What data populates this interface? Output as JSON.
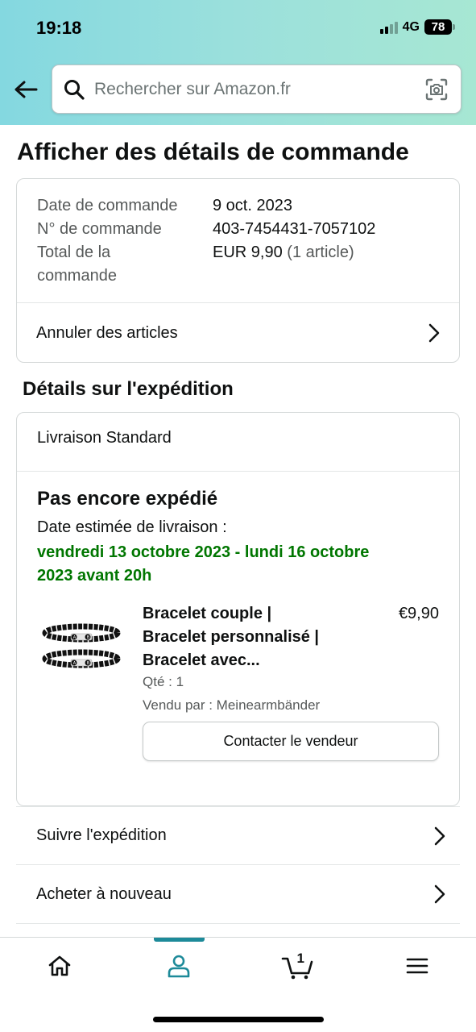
{
  "status_bar": {
    "time": "19:18",
    "network": "4G",
    "battery": "78"
  },
  "search": {
    "placeholder": "Rechercher sur Amazon.fr"
  },
  "page": {
    "title": "Afficher des détails de commande"
  },
  "order": {
    "date_label": "Date de commande",
    "date_value": "9 oct. 2023",
    "number_label": "N° de commande",
    "number_value": "403-7454431-7057102",
    "total_label_line1": "Total de la",
    "total_label_line2": "commande",
    "total_value": "EUR 9,90",
    "total_count": "(1 article)",
    "cancel_label": "Annuler des articles"
  },
  "shipping": {
    "section_title": "Détails sur l'expédition",
    "method": "Livraison Standard",
    "status": "Pas encore expédié",
    "eta_label": "Date estimée de livraison :",
    "eta_line1": "vendredi 13 octobre 2023 - lundi 16 octobre",
    "eta_line2": "2023 avant 20h"
  },
  "product": {
    "name_line1": "Bracelet couple |",
    "name_line2": "Bracelet personnalisé |",
    "name_line3": "Bracelet avec...",
    "price": "€9,90",
    "qty": "Qté : 1",
    "seller": "Vendu par : Meinearmbänder",
    "contact_label": "Contacter le vendeur"
  },
  "actions": {
    "track_label": "Suivre l'expédition",
    "rebuy_label": "Acheter à nouveau"
  },
  "bottom_nav": {
    "cart_count": "1",
    "active_tab": "account",
    "accent_color": "#1d8a99"
  },
  "colors": {
    "eta_green": "#007600",
    "header_gradient_start": "#84d8e0",
    "header_gradient_end": "#a7e7d3"
  }
}
